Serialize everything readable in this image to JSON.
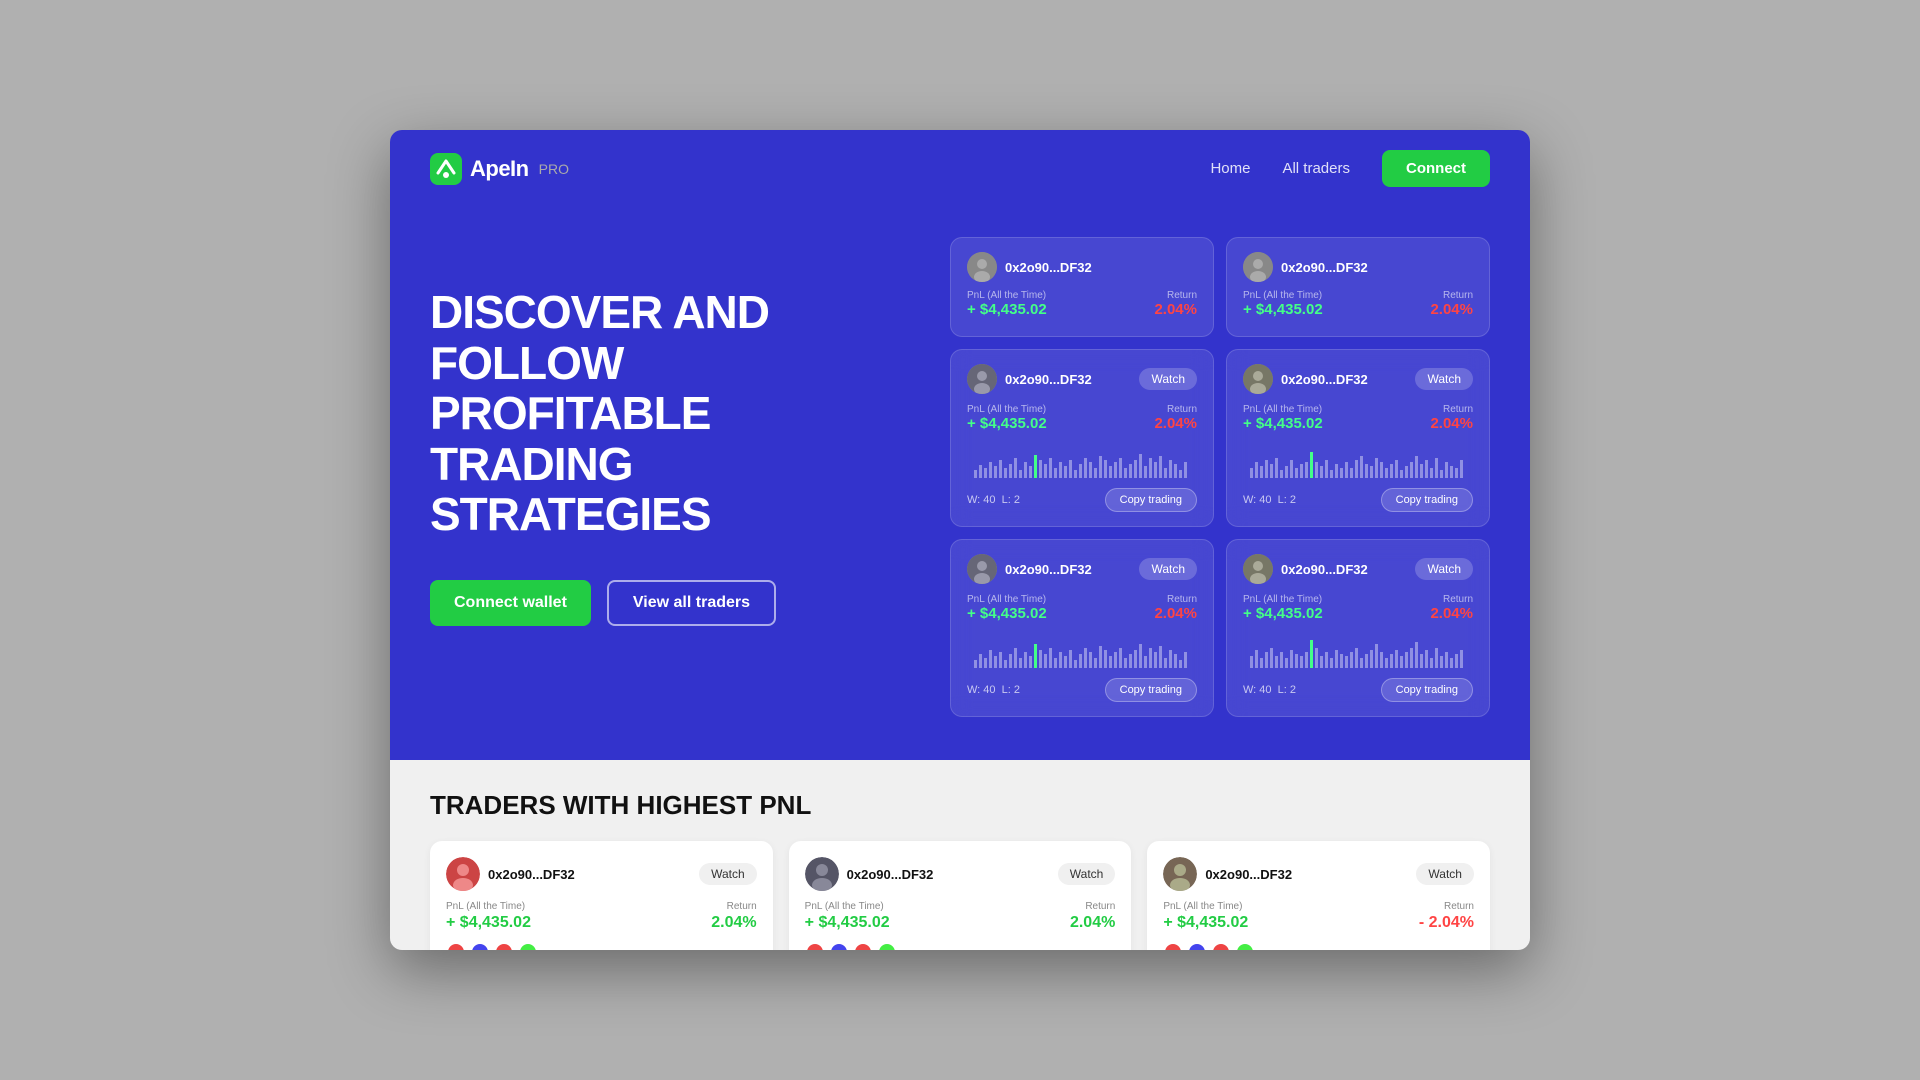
{
  "nav": {
    "logo_text": "ApeIn",
    "logo_pro": "PRO",
    "links": [
      "Home",
      "All traders"
    ],
    "connect_btn": "Connect"
  },
  "hero": {
    "title": "DISCOVER AND FOLLOW PROFITABLE TRADING STRATEGIES",
    "connect_wallet_btn": "Connect wallet",
    "view_traders_btn": "View all traders"
  },
  "trader_cards": [
    {
      "name": "0x2o90...DF32",
      "watch_label": "Watch",
      "pnl_label": "PnL (All the Time)",
      "pnl_value": "+ $4,435.02",
      "return_label": "Return",
      "return_value": "2.04%",
      "return_negative": false,
      "w": "40",
      "l": "2",
      "copy_label": "Copy trading"
    },
    {
      "name": "0x2o90...DF32",
      "watch_label": "Watch",
      "pnl_label": "PnL (All the Time)",
      "pnl_value": "+ $4,435.02",
      "return_label": "Return",
      "return_value": "2.04%",
      "return_negative": false,
      "w": "40",
      "l": "2",
      "copy_label": "Copy trading"
    },
    {
      "name": "0x2o90...DF32",
      "watch_label": "Watch",
      "pnl_label": "PnL (All the Time)",
      "pnl_value": "+ $4,435.02",
      "return_label": "Return",
      "return_value": "2.04%",
      "return_negative": false,
      "w": "40",
      "l": "2",
      "copy_label": "Copy trading"
    },
    {
      "name": "0x2o90...DF32",
      "watch_label": "Watch",
      "pnl_label": "PnL (All the Time)",
      "pnl_value": "+ $4,435.02",
      "return_label": "Return",
      "return_value": "2.04%",
      "return_negative": false,
      "w": "40",
      "l": "2",
      "copy_label": "Copy trading"
    }
  ],
  "bottom": {
    "title": "TRADERS WITH HIGHEST PNL",
    "cards": [
      {
        "name": "0x2o90...DF32",
        "watch_label": "Watch",
        "pnl_label": "PnL (All the Time)",
        "pnl_value": "+ $4,435.02",
        "return_label": "Return",
        "return_value": "2.04%",
        "return_negative": false
      },
      {
        "name": "0x2o90...DF32",
        "watch_label": "Watch",
        "pnl_label": "PnL (All the Time)",
        "pnl_value": "+ $4,435.02",
        "return_label": "Return",
        "return_value": "2.04%",
        "return_negative": false
      },
      {
        "name": "0x2o90...DF32",
        "watch_label": "Watch",
        "pnl_label": "PnL (All the Time)",
        "pnl_value": "+ $4,435.02",
        "return_label": "Return",
        "return_value": "- 2.04%",
        "return_negative": true
      }
    ]
  }
}
